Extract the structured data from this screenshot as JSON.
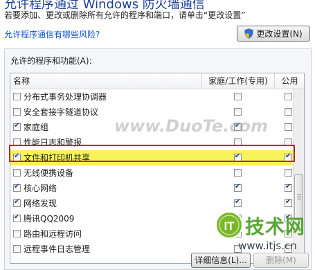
{
  "page": {
    "title": "允许程序通过 Windows 防火墙通信",
    "instruction": "若要添加、更改或删除所有允许的程序和端口，请单击“更改设置”",
    "risk_link": "允许程序通信有哪些风险?",
    "change_settings_label": "更改设置(N)"
  },
  "allowed_programs": {
    "group_label": "允许的程序和功能(A):",
    "columns": {
      "name": "名称",
      "home_work": "家庭/工作(专用)",
      "public": "公用"
    },
    "rows": [
      {
        "label": "分布式事务处理协调器",
        "enabled": false,
        "home_work": false,
        "public": false
      },
      {
        "label": "安全套接字隧道协议",
        "enabled": false,
        "home_work": false,
        "public": false
      },
      {
        "label": "家庭组",
        "enabled": true,
        "home_work": true,
        "public": false
      },
      {
        "label": "性能日志和警报",
        "enabled": false,
        "home_work": false,
        "public": false
      },
      {
        "label": "文件和打印机共享",
        "enabled": true,
        "home_work": true,
        "public": true,
        "highlighted": true
      },
      {
        "label": "无线便携设备",
        "enabled": false,
        "home_work": false,
        "public": false
      },
      {
        "label": "核心网络",
        "enabled": true,
        "home_work": true,
        "public": true
      },
      {
        "label": "网络发现",
        "enabled": true,
        "home_work": true,
        "public": true
      },
      {
        "label": "腾讯QQ2009",
        "enabled": true,
        "home_work": false,
        "public": true
      },
      {
        "label": "路由和远程访问",
        "enabled": false,
        "home_work": false,
        "public": false
      },
      {
        "label": "远程事件日志管理",
        "enabled": false,
        "home_work": false,
        "public": false
      }
    ]
  },
  "buttons": {
    "details_label": "详细信息(L)...",
    "delete_label": "删除(M)"
  },
  "watermarks": {
    "duote": "www.DuoTe.com",
    "itjs_badge": "IT",
    "itjs_brand": "技术网",
    "itjs_url": "www.itjs.cn"
  },
  "colors": {
    "title": "#1d3f9a",
    "link": "#1155cc",
    "highlight_fill": "#f7f35a",
    "highlight_border": "#a33525",
    "itjs_green": "#58a634"
  },
  "icons": {
    "change_settings": "uac-shield-icon"
  }
}
